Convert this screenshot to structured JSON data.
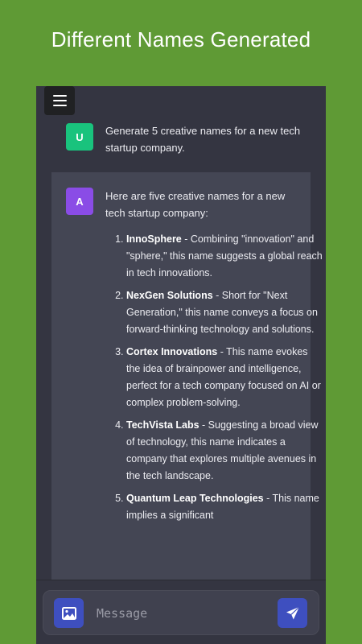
{
  "banner": {
    "title": "Different Names Generated"
  },
  "colors": {
    "banner_background": "#5f9a35",
    "chat_background": "#343541",
    "assistant_background": "#444654",
    "user_avatar": "#19c37d",
    "assistant_avatar": "#8a4ce6",
    "action_button": "#3e4fbf"
  },
  "header": {
    "menu_icon": "hamburger-menu-icon"
  },
  "conversation": {
    "user": {
      "avatar_letter": "U",
      "message": "Generate 5 creative names for a new tech startup company."
    },
    "assistant": {
      "avatar_letter": "A",
      "intro": "Here are five creative names for a new tech startup company:",
      "items": [
        {
          "number": "1.",
          "name": "InnoSphere",
          "description": " - Combining \"innovation\" and \"sphere,\" this name suggests a global reach in tech innovations."
        },
        {
          "number": "2.",
          "name": "NexGen Solutions",
          "description": " - Short for \"Next Generation,\" this name conveys a focus on forward-thinking technology and solutions."
        },
        {
          "number": "3.",
          "name": "Cortex Innovations",
          "description": " - This name evokes the idea of brainpower and intelligence, perfect for a tech company focused on AI or complex problem-solving."
        },
        {
          "number": "4.",
          "name": "TechVista Labs",
          "description": " - Suggesting a broad view of technology, this name indicates a company that explores multiple avenues in the tech landscape."
        },
        {
          "number": "5.",
          "name": "Quantum Leap Technologies",
          "description": " - This name implies a significant"
        }
      ]
    }
  },
  "composer": {
    "placeholder": "Message",
    "image_icon": "image-icon",
    "send_icon": "send-icon"
  }
}
